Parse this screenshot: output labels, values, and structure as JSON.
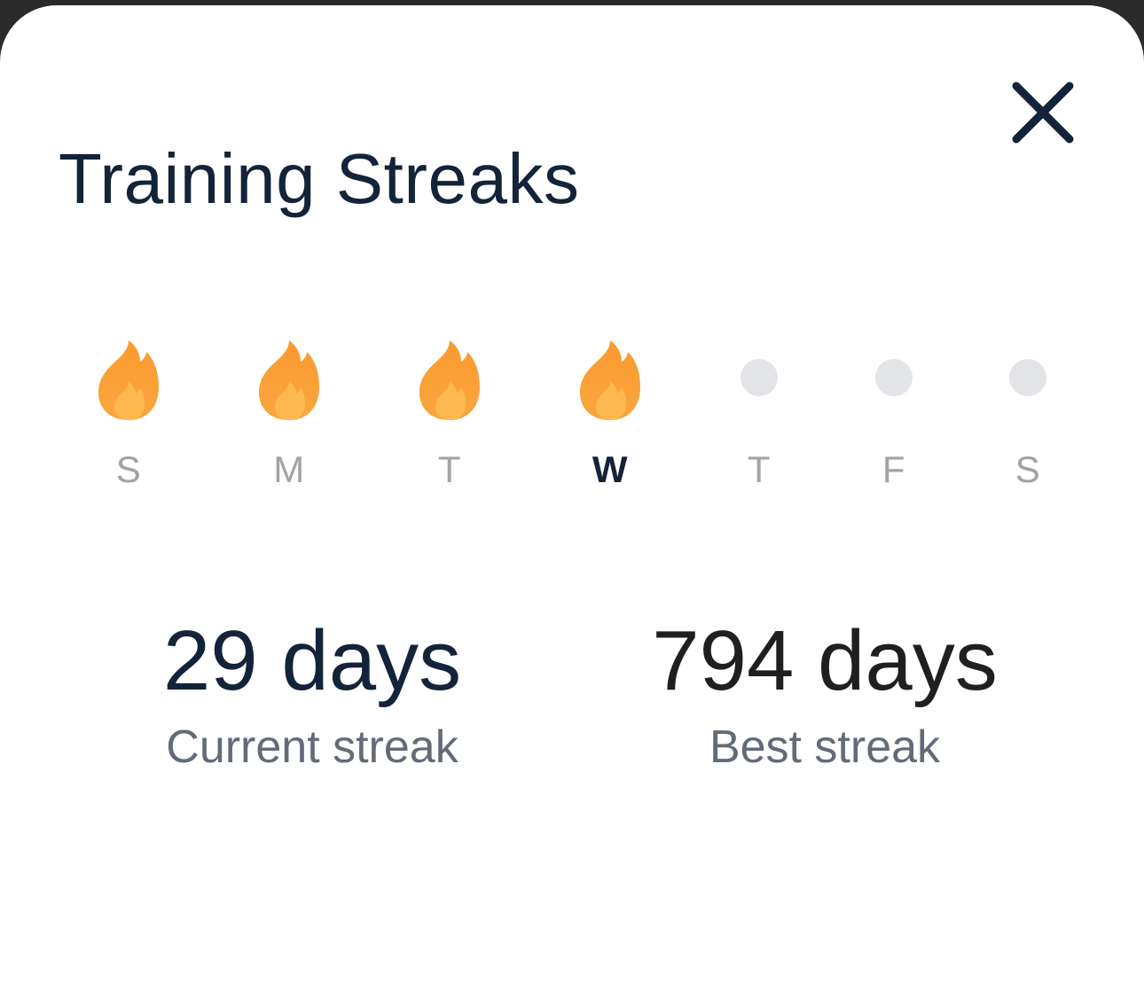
{
  "modal": {
    "title": "Training Streaks",
    "close_icon": "close-icon"
  },
  "week": {
    "days": [
      {
        "label": "S",
        "trained": true,
        "current": false,
        "icon": "flame-icon"
      },
      {
        "label": "M",
        "trained": true,
        "current": false,
        "icon": "flame-icon"
      },
      {
        "label": "T",
        "trained": true,
        "current": false,
        "icon": "flame-icon"
      },
      {
        "label": "W",
        "trained": true,
        "current": true,
        "icon": "flame-icon"
      },
      {
        "label": "T",
        "trained": false,
        "current": false,
        "icon": "empty-dot"
      },
      {
        "label": "F",
        "trained": false,
        "current": false,
        "icon": "empty-dot"
      },
      {
        "label": "S",
        "trained": false,
        "current": false,
        "icon": "empty-dot"
      }
    ]
  },
  "stats": {
    "current": {
      "value": "29 days",
      "label": "Current streak"
    },
    "best": {
      "value": "794 days",
      "label": "Best streak"
    }
  },
  "colors": {
    "title": "#13233a",
    "flame_outer": "#f7a13a",
    "flame_inner": "#fdb94f",
    "inactive_dot": "#e3e4e7",
    "inactive_label": "#a3a3a3",
    "caption": "#636b78"
  }
}
